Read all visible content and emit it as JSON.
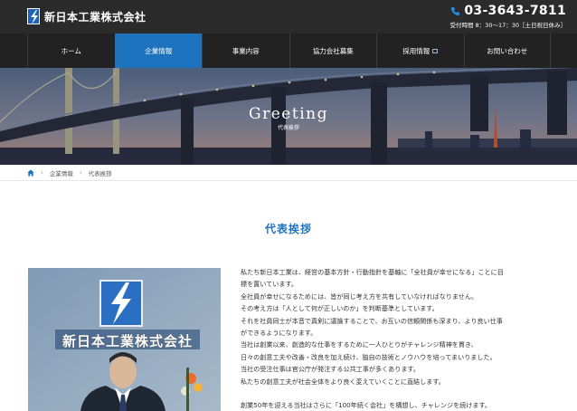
{
  "header": {
    "logo_text": "新日本工業株式会社",
    "phone_number": "03-3643-7811",
    "hours": "受付時間 8：30～17：30［土日祝日休み］"
  },
  "nav": {
    "items": [
      {
        "label": "ホーム"
      },
      {
        "label": "企業情報"
      },
      {
        "label": "事業内容"
      },
      {
        "label": "協力会社募集"
      },
      {
        "label": "採用情報"
      },
      {
        "label": "お問い合わせ"
      }
    ]
  },
  "hero": {
    "title": "Greeting",
    "subtitle": "代表挨拶"
  },
  "breadcrumb": {
    "items": [
      "企業情報",
      "代表挨拶"
    ]
  },
  "main": {
    "section_title": "代表挨拶",
    "photo_brand_text": "新日本工業株式会社",
    "paragraphs": [
      "私たち新日本工業は、経営の基本方針・行動指針を基軸に「全社員が幸せになる」ことに目",
      "標を置いています。",
      "全社員が幸せになるためには、皆が同じ考え方を共有していなければなりません。",
      "その考え方は「人として何が正しいのか」を判断基準としています。",
      "それを社員同士が本音で真剣に議論することで、お互いの信頼関係も深まり、より良い仕事",
      "ができるようになります。",
      "当社は創業以来、創造的な仕事をするために一人ひとりがチャレンジ精神を貫き、",
      "日々の創意工夫や改善・改良を加え続け、独自の技術とノウハウを培ってまいりました。",
      "当社の受注仕事は官公庁が発注する公共工事が多くあります。",
      "私たちの創意工夫が社会全体をより良く変えていくことに直結します。",
      "創業50年を迎える当社はさらに「100年続く会社」を構想し、チャレンジを続けます。"
    ]
  },
  "colors": {
    "header_bg": "#2b2b2b",
    "nav_bg": "#222222",
    "accent": "#1e73be"
  }
}
